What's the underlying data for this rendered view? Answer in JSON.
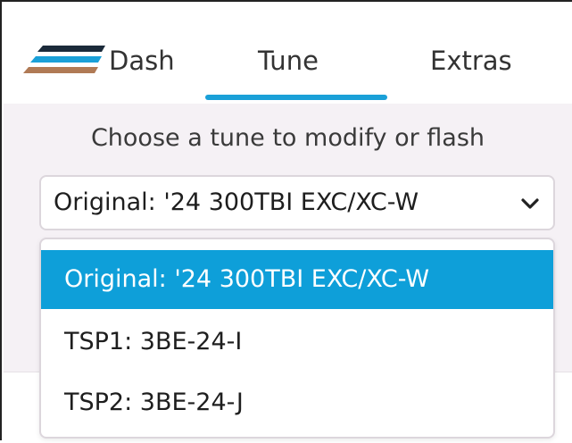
{
  "nav": {
    "tabs": [
      {
        "label": "Dash"
      },
      {
        "label": "Tune"
      },
      {
        "label": "Extras"
      }
    ],
    "active_tab": "Tune",
    "accent_color": "#1aa0d8",
    "logo_colors": [
      "#1b2a3a",
      "#1aa0d8",
      "#b07a55"
    ]
  },
  "main": {
    "instruction": "Choose a tune to modify or flash",
    "select": {
      "value": "Original: '24 300TBI EXC/XC-W",
      "icon": "chevron-down-icon"
    },
    "options": [
      {
        "label": "Original: '24 300TBI EXC/XC-W",
        "selected": true
      },
      {
        "label": "TSP1: 3BE-24-I",
        "selected": false
      },
      {
        "label": "TSP2: 3BE-24-J",
        "selected": false
      }
    ],
    "selected_color": "#0e9fd9"
  }
}
